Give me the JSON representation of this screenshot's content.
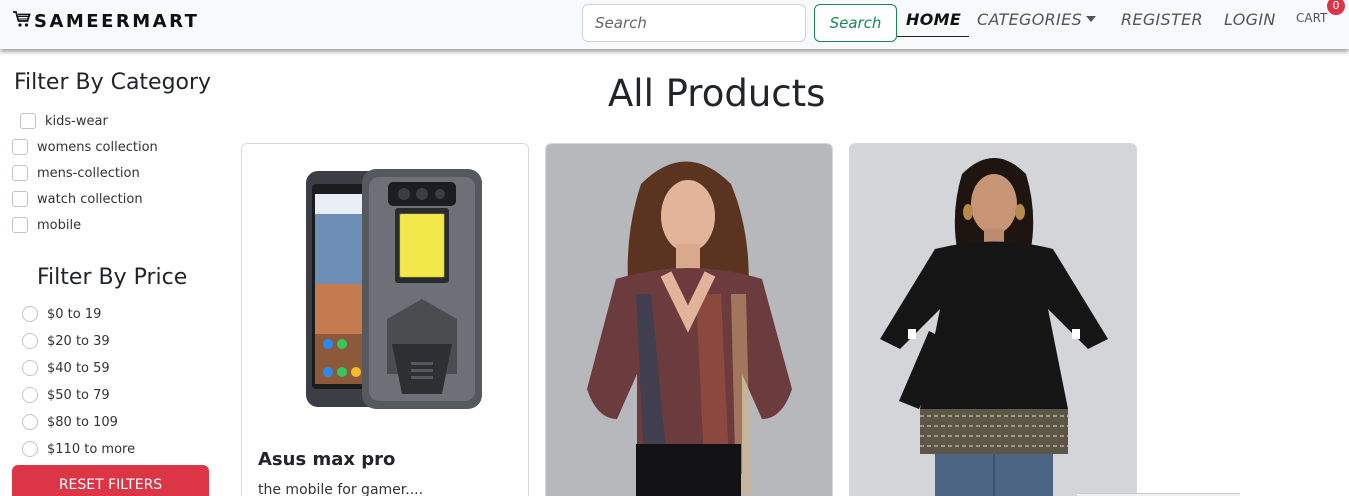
{
  "brand": {
    "name": "SAMEERMART",
    "icon": "cart-icon"
  },
  "search": {
    "placeholder": "Search",
    "button_label": "Search"
  },
  "nav": {
    "home": "HOME",
    "categories": "CATEGORIES",
    "register": "REGISTER",
    "login": "LOGIN",
    "cart": "CART",
    "cart_count": "0"
  },
  "filters": {
    "category_title": "Filter By Category",
    "categories": [
      "kids-wear",
      "womens collection",
      "mens-collection",
      "watch collection",
      "mobile"
    ],
    "price_title": "Filter By Price",
    "prices": [
      "$0 to 19",
      "$20 to 39",
      "$40 to 59",
      "$50 to 79",
      "$80 to 109",
      "$110 to more"
    ],
    "reset_label": "RESET FILTERS"
  },
  "main": {
    "title": "All Products",
    "products": [
      {
        "name": "Asus max pro",
        "description": "the mobile for gamer....",
        "image": "rugged-phone"
      },
      {
        "name": "",
        "description": "",
        "image": "woman-printed-wrap-top"
      },
      {
        "name": "",
        "description": "",
        "image": "woman-black-tunic"
      }
    ]
  },
  "colors": {
    "accent_green": "#198754",
    "danger_red": "#dc3545",
    "navbar_bg": "#f8f9fa"
  }
}
